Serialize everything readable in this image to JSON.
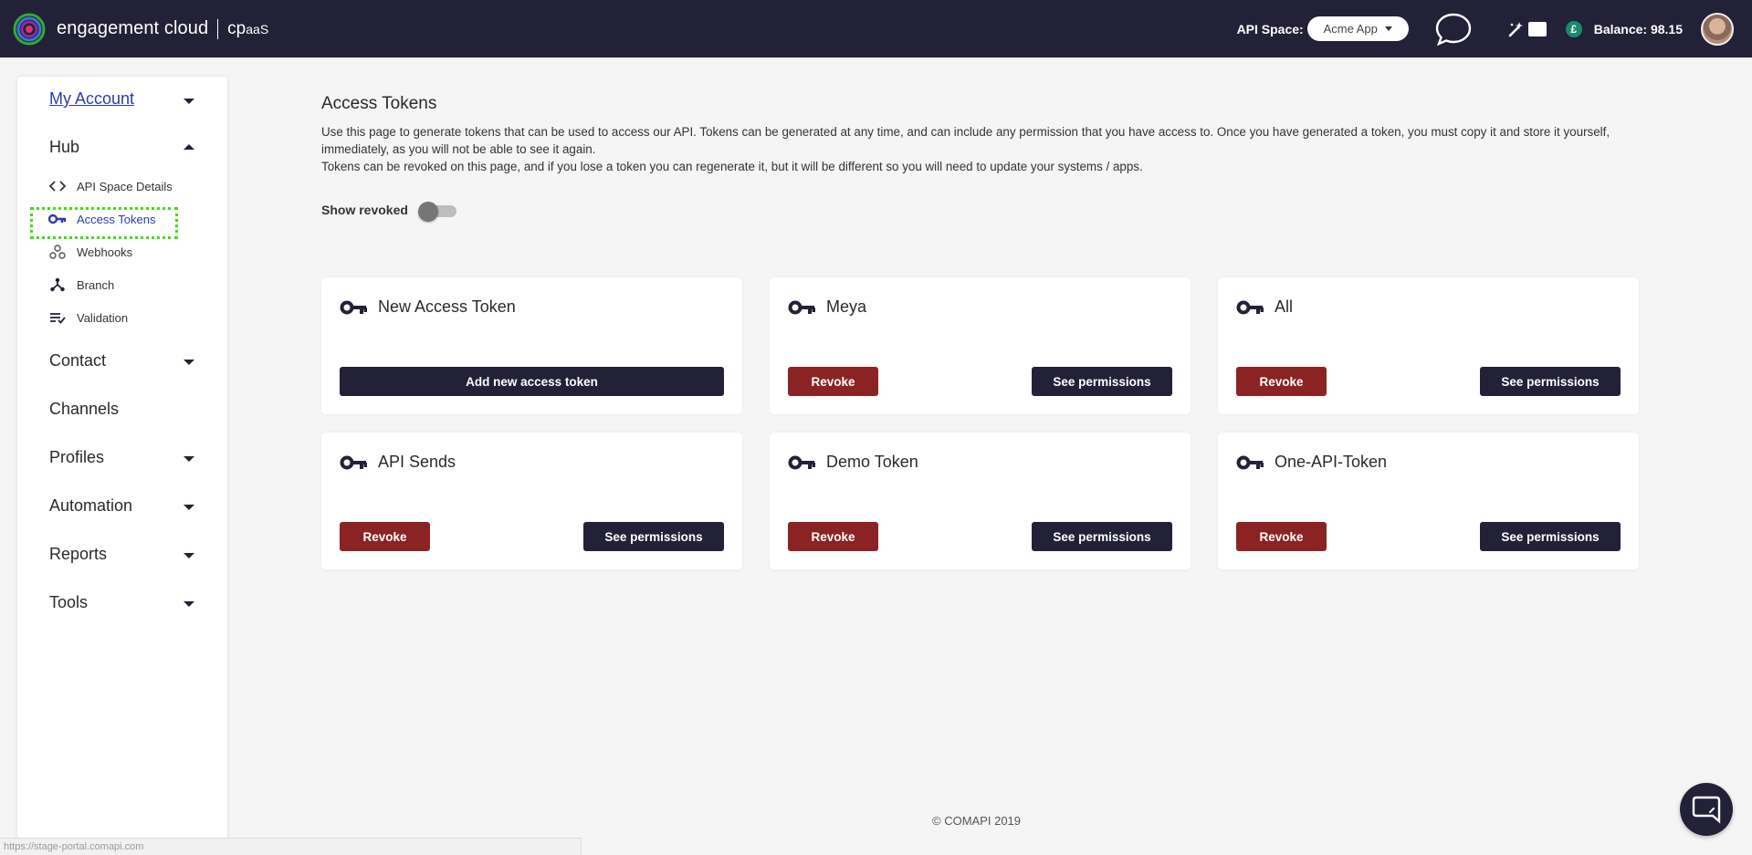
{
  "brand": {
    "name": "engagement cloud",
    "product_main": "cp",
    "product_small": "aaS"
  },
  "header": {
    "api_space_label": "API Space:",
    "api_space_value": "Acme App",
    "balance_currency": "£",
    "balance_text": "Balance: 98.15"
  },
  "sidebar": {
    "my_account": "My Account",
    "hub": "Hub",
    "hub_items": [
      {
        "label": "API Space Details",
        "icon": "code-icon"
      },
      {
        "label": "Access Tokens",
        "icon": "key-icon"
      },
      {
        "label": "Webhooks",
        "icon": "webhook-icon"
      },
      {
        "label": "Branch",
        "icon": "branch-icon"
      },
      {
        "label": "Validation",
        "icon": "validation-icon"
      }
    ],
    "contact": "Contact",
    "channels": "Channels",
    "profiles": "Profiles",
    "automation": "Automation",
    "reports": "Reports",
    "tools": "Tools"
  },
  "main": {
    "title": "Access Tokens",
    "desc_line1": "Use this page to generate tokens that can be used to access our API. Tokens can be generated at any time, and can include any permission that you have access to. Once you have generated a token, you must copy it and store it yourself, immediately, as you will not be able to see it again.",
    "desc_line2": "Tokens can be revoked on this page, and if you lose a token you can regenerate it, but it will be different so you will need to update your systems / apps.",
    "show_revoked_label": "Show revoked",
    "new_token_title": "New Access Token",
    "add_button": "Add new access token",
    "revoke_label": "Revoke",
    "permissions_label": "See permissions",
    "tokens": [
      "Meya",
      "All",
      "API Sends",
      "Demo Token",
      "One-API-Token"
    ]
  },
  "footer": {
    "copyright": "© COMAPI 2019"
  },
  "status_bar": {
    "url": "https://stage-portal.comapi.com"
  },
  "colors": {
    "topbar": "#232137",
    "revoke": "#8b2325",
    "accent": "#2c3bb0",
    "selection_outline": "#3be00f"
  }
}
